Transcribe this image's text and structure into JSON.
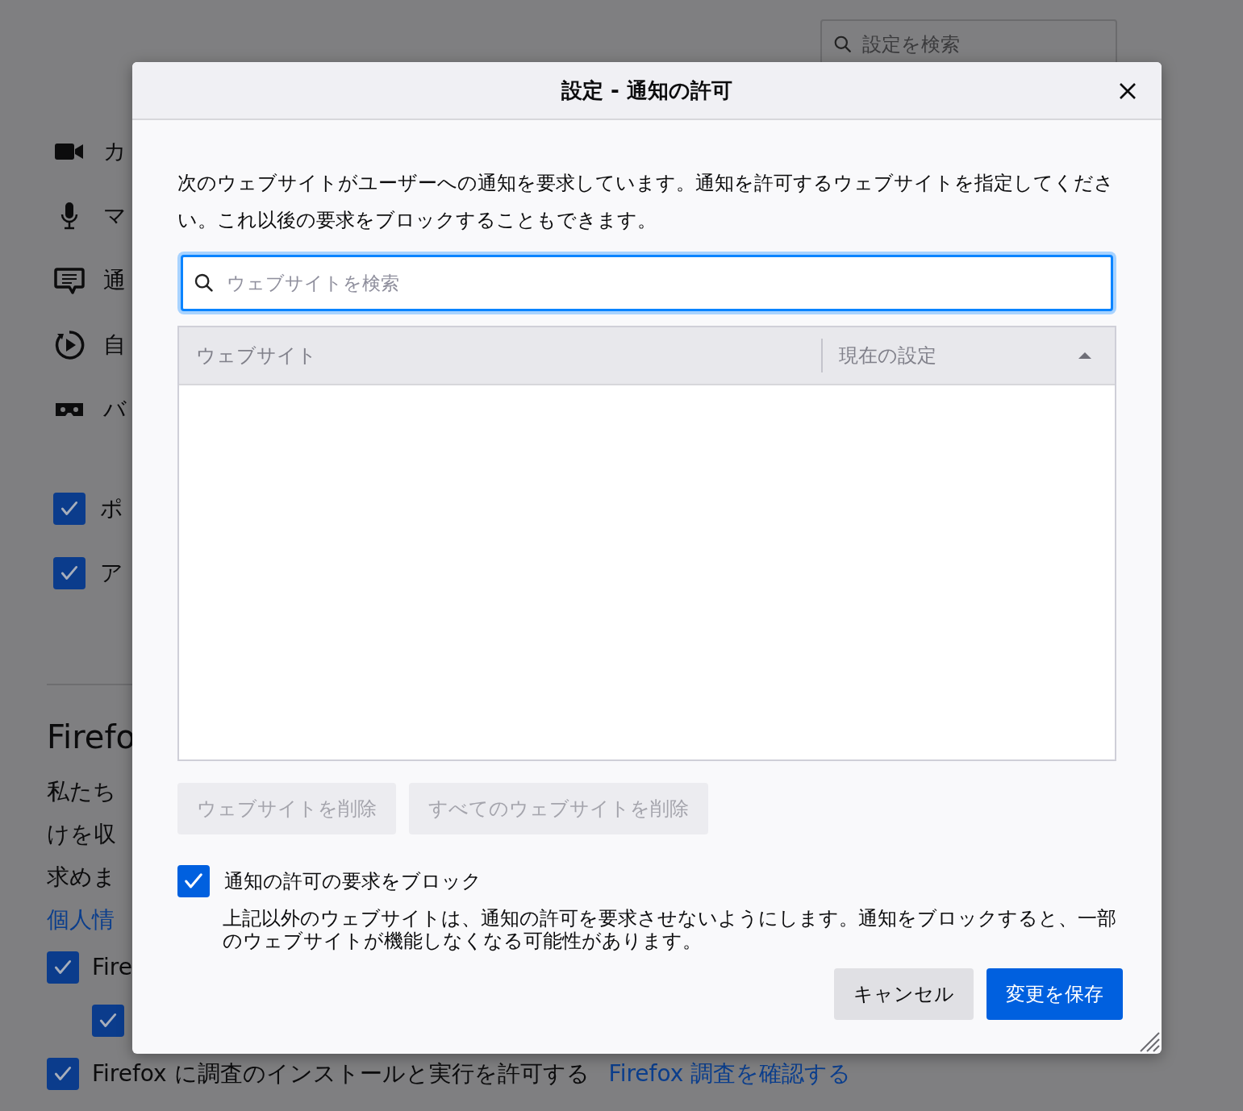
{
  "background_page": {
    "search": {
      "placeholder": "設定を検索"
    },
    "permissions": [
      {
        "kind": "camera",
        "label": "カ"
      },
      {
        "kind": "microphone",
        "label": "マ"
      },
      {
        "kind": "notification",
        "label": "通"
      },
      {
        "kind": "autoplay",
        "label": "自"
      },
      {
        "kind": "vr",
        "label": "バ"
      }
    ],
    "checkboxes": [
      {
        "label": "ポ",
        "checked": true
      },
      {
        "label": "ア",
        "checked": true
      }
    ],
    "section_title": "Firefo",
    "paragraph_lines": [
      "私たち",
      "けを収",
      "求めま"
    ],
    "link": "個人情",
    "options": [
      {
        "label": "Fire",
        "checked": true,
        "children": [
          {
            "checked": true
          }
        ]
      },
      {
        "label": "Firefox に調査のインストールと実行を許可する",
        "checked": true,
        "link": "Firefox 調査を確認する"
      }
    ]
  },
  "dialog": {
    "title": "設定 - 通知の許可",
    "description": "次のウェブサイトがユーザーへの通知を要求しています。通知を許可するウェブサイトを指定してください。これ以後の要求をブロックすることもできます。",
    "search": {
      "placeholder": "ウェブサイトを検索"
    },
    "table": {
      "columns": [
        {
          "label": "ウェブサイト"
        },
        {
          "label": "現在の設定",
          "sorted_ascending": true
        }
      ]
    },
    "actions": [
      {
        "label": "ウェブサイトを削除",
        "disabled": true
      },
      {
        "label": "すべてのウェブサイトを削除",
        "disabled": true
      }
    ],
    "block_option": {
      "label": "通知の許可の要求をブロック",
      "checked": true,
      "description": "上記以外のウェブサイトは、通知の許可を要求させないようにします。通知をブロックすると、一部のウェブサイトが機能しなくなる可能性があります。"
    },
    "buttons": [
      {
        "label": "キャンセル",
        "kind": "secondary"
      },
      {
        "label": "変更を保存",
        "kind": "primary"
      }
    ]
  }
}
